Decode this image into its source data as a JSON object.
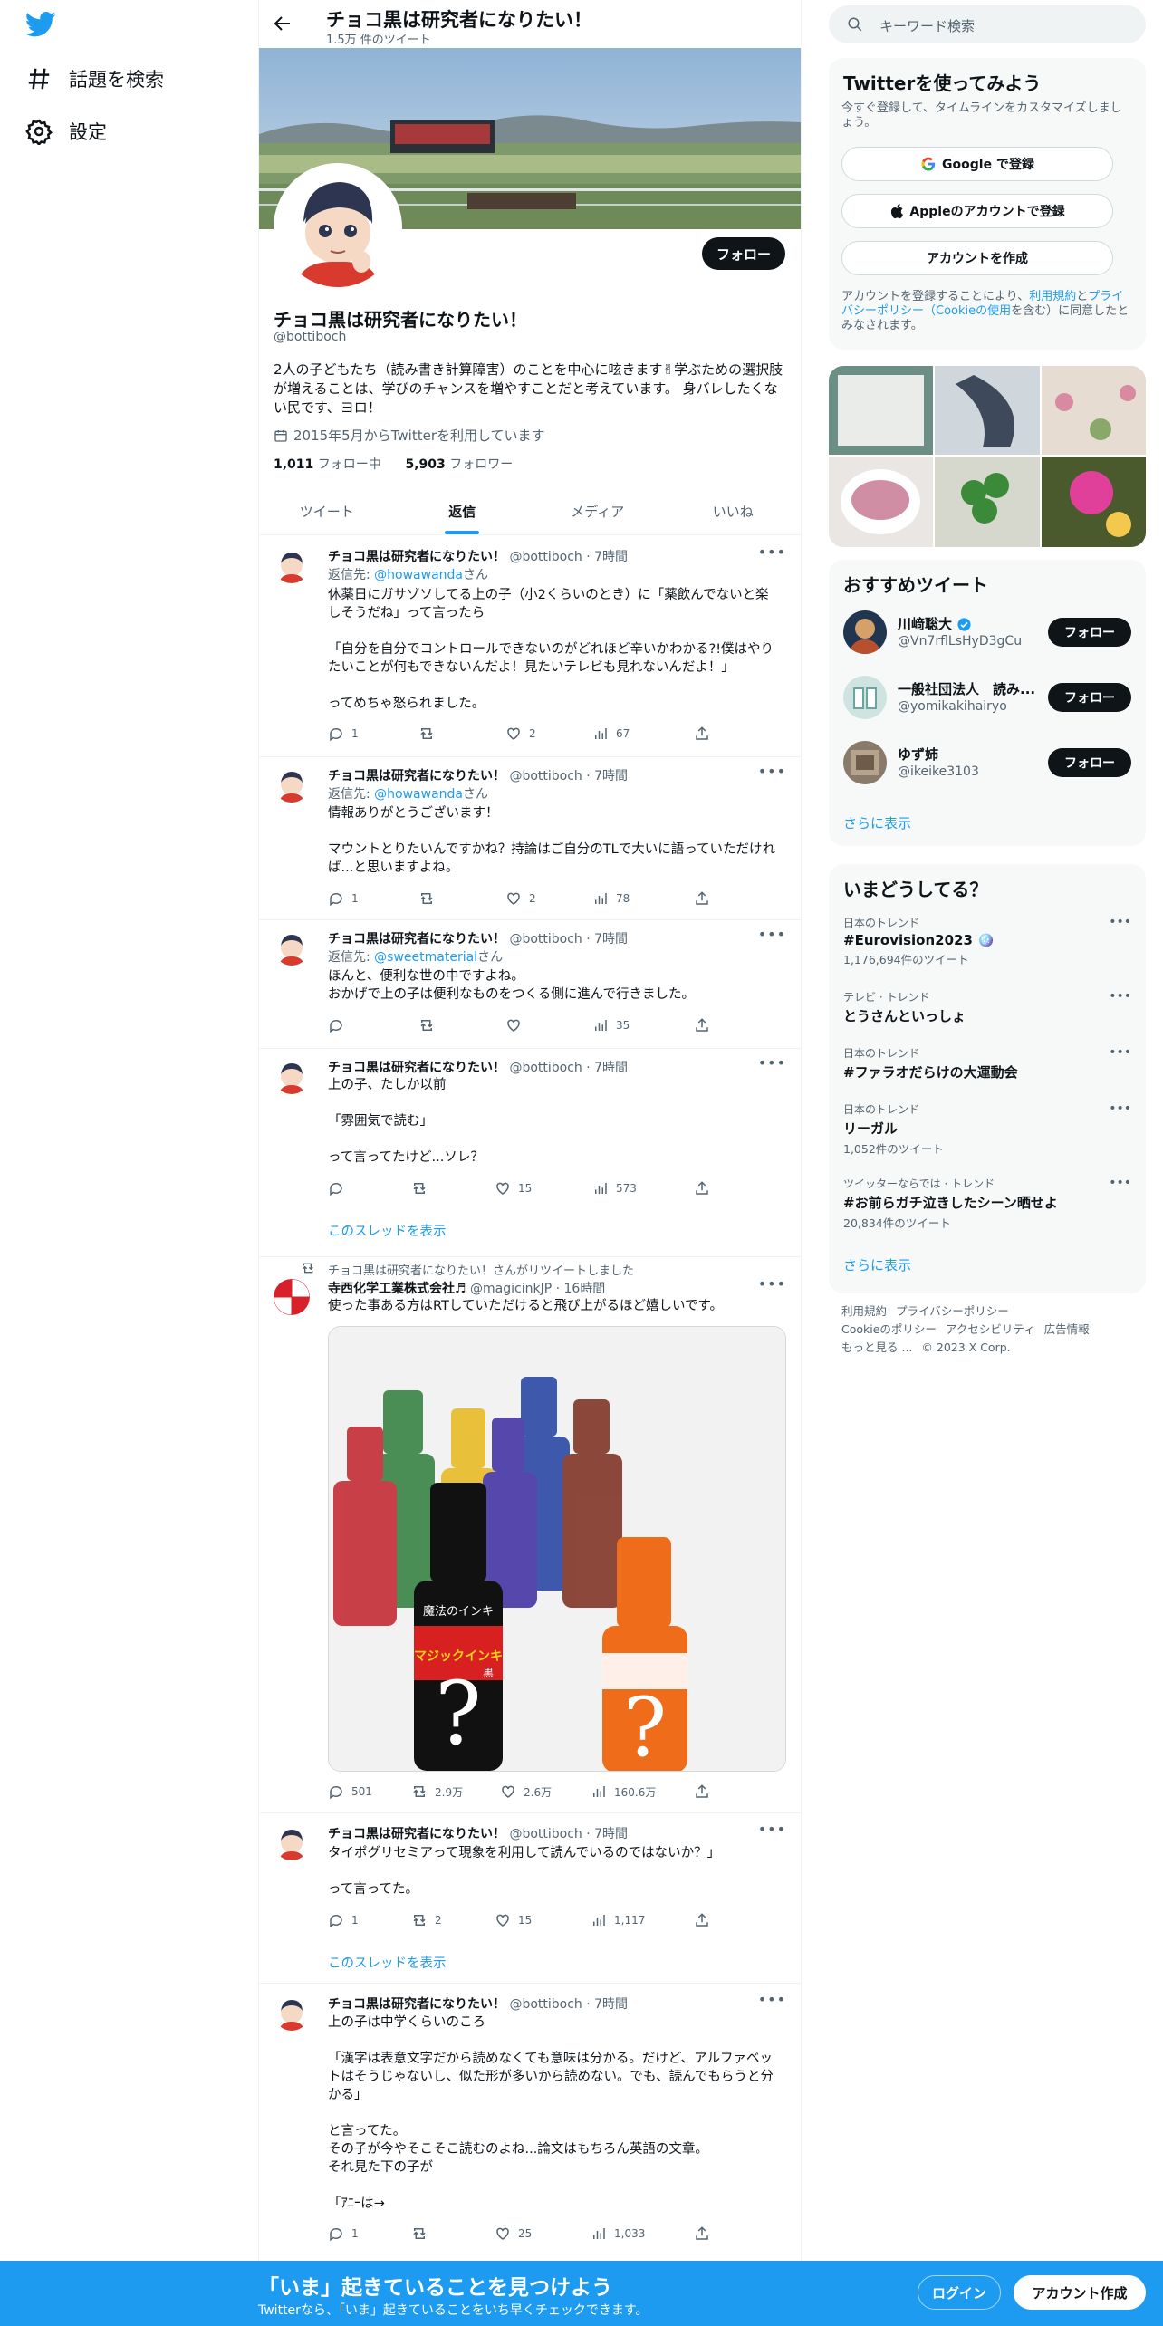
{
  "nav": {
    "explore_label": "話題を検索",
    "settings_label": "設定"
  },
  "header": {
    "title": "チョコ黒は研究者になりたい！",
    "subtitle": "1.5万 件のツイート"
  },
  "profile": {
    "follow_label": "フォロー",
    "name": "チョコ黒は研究者になりたい！",
    "handle": "@bottiboch",
    "bio": "2人の子どもたち（読み書き計算障害）のことを中心に呟きます✌学ぶための選択肢が増えることは、学びのチャンスを増やすことだと考えています。 身バレしたくない民です、ヨロ！",
    "joined": "2015年5月からTwitterを利用しています",
    "following_count": "1,011",
    "following_label": "フォロー中",
    "followers_count": "5,903",
    "followers_label": "フォロワー"
  },
  "tabs": [
    "ツイート",
    "返信",
    "メディア",
    "いいね"
  ],
  "tweets": [
    {
      "name": "チョコ黒は研究者になりたい！",
      "meta": "@bottiboch · 7時間",
      "reply_prefix": "返信先: ",
      "reply_to": "@howawanda",
      "reply_suffix": "さん",
      "text": "休薬日にガサゾソしてる上の子（小2くらいのとき）に「薬飲んでないと楽しそうだね」って言ったら\n\n「自分を自分でコントロールできないのがどれほど辛いかわかる?!僕はやりたいことが何もできないんだよ！見たいテレビも見れないんだよ！」\n\nってめちゃ怒られました。",
      "replies": "1",
      "retweets": "",
      "likes": "2",
      "views": "67"
    },
    {
      "name": "チョコ黒は研究者になりたい！",
      "meta": "@bottiboch · 7時間",
      "reply_prefix": "返信先: ",
      "reply_to": "@howawanda",
      "reply_suffix": "さん",
      "text": "情報ありがとうございます！\n\nマウントとりたいんですかね？持論はご自分のTLで大いに語っていただければ...と思いますよね。",
      "replies": "1",
      "retweets": "",
      "likes": "2",
      "views": "78"
    },
    {
      "name": "チョコ黒は研究者になりたい！",
      "meta": "@bottiboch · 7時間",
      "reply_prefix": "返信先: ",
      "reply_to": "@sweetmaterial",
      "reply_suffix": "さん",
      "text": "ほんと、便利な世の中ですよね。\nおかげで上の子は便利なものをつくる側に進んで行きました。",
      "replies": "",
      "retweets": "",
      "likes": "",
      "views": "35"
    },
    {
      "name": "チョコ黒は研究者になりたい！",
      "meta": "@bottiboch · 7時間",
      "text": "上の子、たしか以前\n\n「雰囲気で読む」\n\nって言ってたけど...ソレ？",
      "replies": "",
      "retweets": "",
      "likes": "15",
      "views": "573",
      "thread_link": "このスレッドを表示"
    },
    {
      "retweet_note": "チョコ黒は研究者になりたい！さんがリツイートしました",
      "name": "寺西化学工業株式会社♬",
      "meta": "@magicinkJP · 16時間",
      "text": "使った事ある方はRTしていただけると飛び上がるほど嬉しいです。",
      "image_label_top": "魔法のインキ",
      "image_label_main": "マジックインキ",
      "image_label_sub": "黒",
      "replies": "501",
      "retweets": "2.9万",
      "likes": "2.6万",
      "views": "160.6万"
    },
    {
      "name": "チョコ黒は研究者になりたい！",
      "meta": "@bottiboch · 7時間",
      "text": "タイポグリセミアって現象を利用して読んでいるのではないか？」\n\nって言ってた。",
      "replies": "1",
      "retweets": "2",
      "likes": "15",
      "views": "1,117",
      "thread_link": "このスレッドを表示"
    },
    {
      "name": "チョコ黒は研究者になりたい！",
      "meta": "@bottiboch · 7時間",
      "text": "上の子は中学くらいのころ\n\n「漢字は表意文字だから読めなくても意味は分かる。だけど、アルファベットはそうじゃないし、似た形が多いから読めない。でも、読んでもらうと分かる」\n\nと言ってた。\nその子が今やそこそこ読むのよね...論文はもちろん英語の文章。\nそれ見た下の子が\n\n「ｱﾆｰは→",
      "replies": "1",
      "retweets": "",
      "likes": "25",
      "views": "1,033"
    }
  ],
  "right": {
    "search_placeholder": "キーワード検索",
    "signup": {
      "title": "Twitterを使ってみよう",
      "subtitle": "今すぐ登録して、タイムラインをカスタマイズしましょう。",
      "google": "Google で登録",
      "apple": "Appleのアカウントで登録",
      "create": "アカウントを作成",
      "legal_1": "アカウントを登録することにより、",
      "legal_terms": "利用規約",
      "legal_2": "と",
      "legal_privacy": "プライバシーポリシー（Cookieの使用",
      "legal_3": "を含む）に同意したとみなされます。"
    },
    "who_to_follow": {
      "title": "おすすめツイート",
      "users": [
        {
          "name": "川﨑聡大",
          "handle": "@Vn7rflLsHyD3gCu",
          "verified": true
        },
        {
          "name": "一般社団法人　読み...",
          "handle": "@yomikakihairyo",
          "verified": false
        },
        {
          "name": "ゆず姉",
          "handle": "@ikeike3103",
          "verified": false
        }
      ],
      "follow_label": "フォロー",
      "more": "さらに表示"
    },
    "trends": {
      "title": "いまどうしてる？",
      "items": [
        {
          "context": "日本のトレンド",
          "name": "#Eurovision2023 🪩",
          "count": "1,176,694件のツイート"
        },
        {
          "context": "テレビ · トレンド",
          "name": "とうさんといっしょ",
          "count": ""
        },
        {
          "context": "日本のトレンド",
          "name": "#ファラオだらけの大運動会",
          "count": ""
        },
        {
          "context": "日本のトレンド",
          "name": "リーガル",
          "count": "1,052件のツイート"
        },
        {
          "context": "ツイッターならでは · トレンド",
          "name": "#お前らガチ泣きしたシーン晒せよ",
          "count": "20,834件のツイート"
        }
      ],
      "more": "さらに表示"
    },
    "footer": {
      "terms": "利用規約",
      "privacy": "プライバシーポリシー",
      "cookie": "Cookieのポリシー",
      "accessibility": "アクセシビリティ",
      "ads": "広告情報",
      "more": "もっと見る ...",
      "copyright": "© 2023 X Corp."
    }
  },
  "bottom_bar": {
    "title": "「いま」起きていることを見つけよう",
    "subtitle": "Twitterなら、「いま」起きていることをいち早くチェックできます。",
    "login": "ログイン",
    "signup": "アカウント作成"
  },
  "colors": {
    "accent": "#1d9bf0",
    "text": "#0f1419",
    "muted": "#536471",
    "button_dark": "#0f1419"
  }
}
